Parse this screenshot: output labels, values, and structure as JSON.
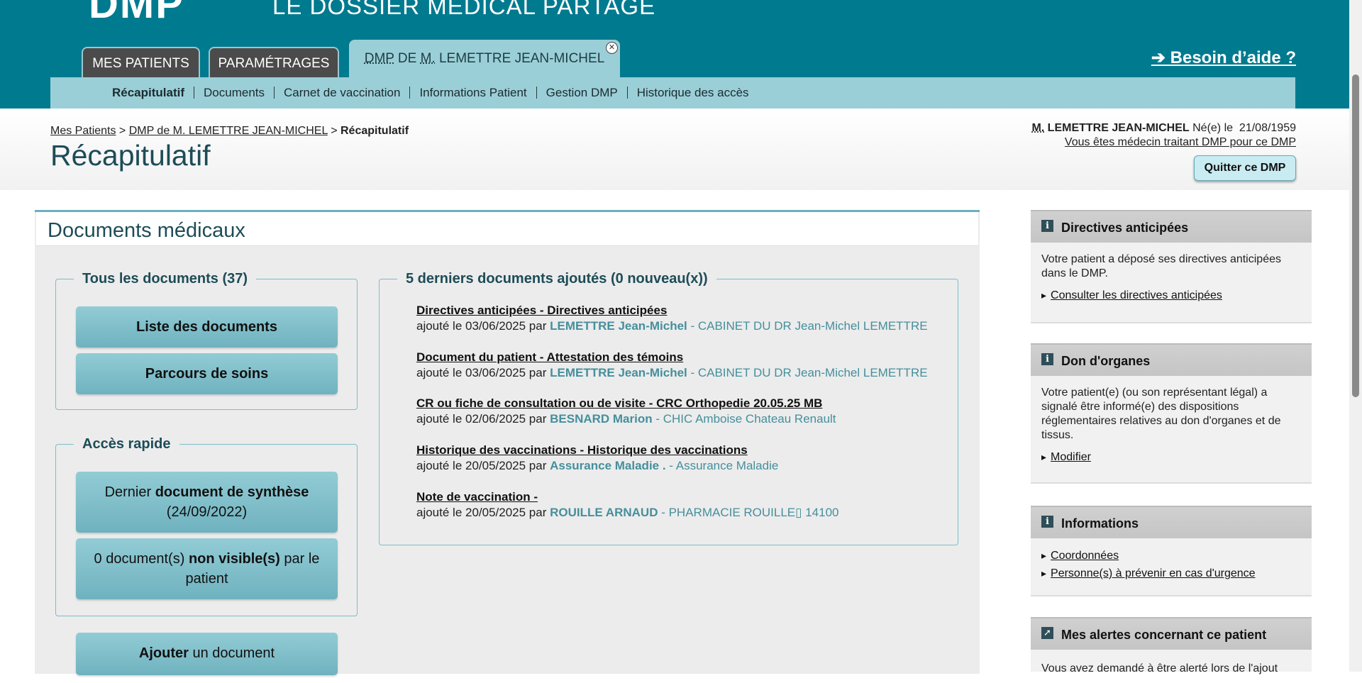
{
  "header": {
    "logo": "DMP",
    "brand": "LE DOSSIER MÉDICAL PARTAGÉ",
    "tabs": [
      {
        "label": "MES PATIENTS"
      },
      {
        "label": "PARAMÉTRAGES"
      },
      {
        "label_abbr1": "DMP",
        "label_mid": " DE ",
        "label_abbr2": "M.",
        "label_rest": " LEMETTRE JEAN-MICHEL"
      }
    ],
    "help": "➔ Besoin d’aide ?"
  },
  "subnav": {
    "items": [
      "Récapitulatif",
      "Documents",
      "Carnet de vaccination",
      "Informations Patient",
      "Gestion DMP",
      "Historique des accès"
    ]
  },
  "breadcrumb": {
    "item1": "Mes Patients",
    "sep1": " > ",
    "item2": "DMP de M. LEMETTRE JEAN-MICHEL",
    "sep2": " > ",
    "current": "Récapitulatif"
  },
  "page": {
    "title": "Récapitulatif"
  },
  "patient": {
    "civ": "M.",
    "name": " LEMETTRE JEAN-MICHEL",
    "born_label": " Né(e) le ",
    "born_date": "21/08/1959",
    "note": "Vous êtes médecin traitant DMP pour ce DMP",
    "quit": "Quitter ce DMP"
  },
  "main": {
    "title": "Documents médicaux",
    "all_docs": {
      "legend": "Tous les documents (37)",
      "list_btn": "Liste des documents",
      "care_btn": "Parcours de soins"
    },
    "quick": {
      "legend": "Accès rapide",
      "synth_pre": "Dernier ",
      "synth_bold": "document de synthèse",
      "synth_date": "(24/09/2022)",
      "hidden_pre": "0 document(s) ",
      "hidden_bold": "non visible(s)",
      "hidden_post": " par le patient"
    },
    "add": {
      "bold": "Ajouter",
      "rest": " un document"
    },
    "recent": {
      "legend": "5 derniers documents ajoutés (0 nouveau(x))",
      "docs": [
        {
          "title": "Directives anticipées - Directives anticipées",
          "meta": "ajouté le 03/06/2025 par ",
          "author": "LEMETTRE Jean-Michel",
          "org": " - CABINET DU DR Jean-Michel LEMETTRE"
        },
        {
          "title": "Document du patient - Attestation des témoins",
          "meta": "ajouté le 03/06/2025 par ",
          "author": "LEMETTRE Jean-Michel",
          "org": " - CABINET DU DR Jean-Michel LEMETTRE"
        },
        {
          "title": "CR ou fiche de consultation ou de visite - CRC Orthopedie 20.05.25 MB",
          "meta": "ajouté le 02/06/2025 par ",
          "author": "BESNARD Marion",
          "org": " - CHIC Amboise Chateau Renault"
        },
        {
          "title": "Historique des vaccinations - Historique des vaccinations",
          "meta": "ajouté le 20/05/2025 par ",
          "author": "Assurance Maladie .",
          "org": " - Assurance Maladie"
        },
        {
          "title": "Note de vaccination -",
          "meta": "ajouté le 20/05/2025 par ",
          "author": "ROUILLE ARNAUD",
          "org": " - PHARMACIE ROUILLE▯ 14100"
        }
      ]
    }
  },
  "sidebar": {
    "directives": {
      "title": "Directives anticipées",
      "text": "Votre patient a déposé ses directives anticipées dans le DMP.",
      "link": "Consulter les directives anticipées"
    },
    "organs": {
      "title": "Don d'organes",
      "text": "Votre patient(e) (ou son représentant légal) a signalé être informé(e) des dispositions réglementaires relatives au don d'organes et de tissus.",
      "link": "Modifier"
    },
    "infos": {
      "title": "Informations",
      "link1": "Coordonnées",
      "link2": "Personne(s) à prévenir en cas d'urgence"
    },
    "alerts": {
      "title": "Mes alertes concernant ce patient",
      "text": "Vous avez demandé à être alerté lors de l'ajout"
    }
  }
}
